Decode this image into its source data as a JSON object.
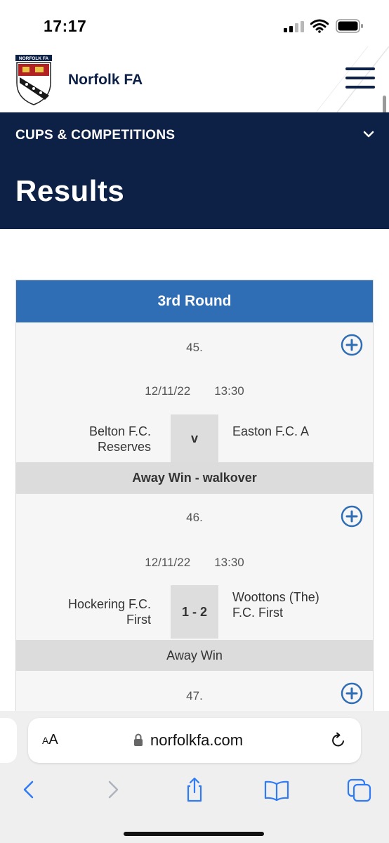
{
  "status_bar": {
    "time": "17:17",
    "icons": [
      "signal-icon",
      "wifi-icon",
      "battery-icon"
    ]
  },
  "site": {
    "crest_text": "NORFOLK FA",
    "brand_name": "Norfolk FA",
    "menu_icon": "hamburger-menu-icon"
  },
  "section_nav": {
    "label": "CUPS & COMPETITIONS",
    "icon": "chevron-down-icon"
  },
  "page": {
    "title": "Results"
  },
  "round": {
    "title": "3rd Round"
  },
  "fixtures": [
    {
      "number": "45.",
      "date": "12/11/22",
      "time": "13:30",
      "home": "Belton F.C. Reserves",
      "score": "v",
      "away": "Easton F.C. A",
      "result": "Away Win - walkover"
    },
    {
      "number": "46.",
      "date": "12/11/22",
      "time": "13:30",
      "home": "Hockering F.C. First",
      "score": "1 - 2",
      "away": "Woottons (The) F.C. First",
      "result": "Away Win"
    },
    {
      "number": "47."
    }
  ],
  "browser": {
    "reader_label_small": "A",
    "reader_label_large": "A",
    "url": "norfolkfa.com"
  },
  "toolbar": [
    "back-icon",
    "forward-icon",
    "share-icon",
    "bookmarks-icon",
    "tabs-icon"
  ],
  "colors": {
    "navy": "#0d2146",
    "round_header_blue": "#2f6db5",
    "expand_icon_blue": "#2f6db5",
    "browser_blue": "#2f7bf5"
  }
}
